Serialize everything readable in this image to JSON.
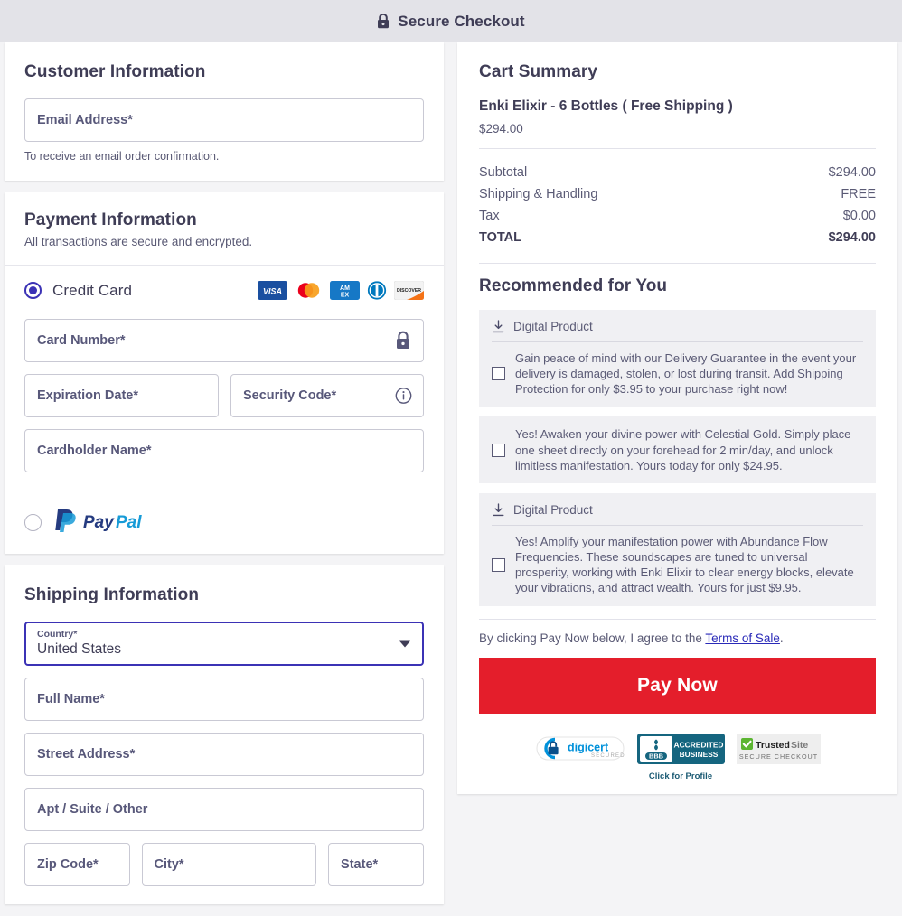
{
  "header": {
    "title": "Secure Checkout",
    "icon": "lock-icon"
  },
  "customer": {
    "heading": "Customer Information",
    "email_label": "Email Address*",
    "email_value": "",
    "email_hint": "To receive an email order confirmation."
  },
  "payment": {
    "heading": "Payment Information",
    "subheading": "All transactions are secure and encrypted.",
    "methods": [
      {
        "label": "Credit Card",
        "selected": true
      },
      {
        "label": "PayPal",
        "selected": false
      }
    ],
    "card_brands": [
      "visa",
      "mastercard",
      "amex",
      "diners-club",
      "discover"
    ],
    "fields": {
      "card_number": "Card Number*",
      "expiration": "Expiration Date*",
      "security_code": "Security Code*",
      "cardholder": "Cardholder Name*"
    },
    "card_number_icon": "lock-icon",
    "security_code_icon": "info-icon"
  },
  "shipping": {
    "heading": "Shipping Information",
    "country_label": "Country*",
    "country_value": "United States",
    "full_name": "Full Name*",
    "street": "Street Address*",
    "apt": "Apt / Suite / Other",
    "zip": "Zip Code*",
    "city": "City*",
    "state": "State*"
  },
  "cart": {
    "heading": "Cart Summary",
    "product_name": "Enki Elixir - 6 Bottles ( Free Shipping )",
    "product_price": "$294.00",
    "lines": [
      {
        "label": "Subtotal",
        "value": "$294.00"
      },
      {
        "label": "Shipping & Handling",
        "value": "FREE"
      },
      {
        "label": "Tax",
        "value": "$0.00"
      }
    ],
    "total_label": "TOTAL",
    "total_value": "$294.00"
  },
  "recommended": {
    "heading": "Recommended for You",
    "digital_tag": "Digital Product",
    "items": [
      {
        "digital": true,
        "checked": false,
        "text": "Gain peace of mind with our Delivery Guarantee in the event your delivery is damaged, stolen, or lost during transit. Add Shipping Protection for only $3.95 to your purchase right now!"
      },
      {
        "digital": false,
        "checked": false,
        "text": "Yes! Awaken your divine power with Celestial Gold. Simply place one sheet directly on your forehead for 2 min/day, and unlock limitless manifestation. Yours today for only $24.95."
      },
      {
        "digital": true,
        "checked": false,
        "text": "Yes! Amplify your manifestation power with Abundance Flow Frequencies. These soundscapes are tuned to universal prosperity, working with Enki Elixir to clear energy blocks, elevate your vibrations, and attract wealth.  Yours for just $9.95."
      }
    ]
  },
  "checkout": {
    "terms_prefix": "By clicking Pay Now below, I agree to the ",
    "terms_link": "Terms of Sale",
    "terms_suffix": ".",
    "pay_button": "Pay Now"
  },
  "badges": [
    {
      "name": "digicert",
      "primary": "digicert",
      "secondary": "SECURED"
    },
    {
      "name": "bbb",
      "primary": "ACCREDITED",
      "secondary": "BUSINESS",
      "caption": "Click for Profile",
      "mark": "BBB"
    },
    {
      "name": "trustedsite",
      "primary": "TrustedSite",
      "secondary": "SECURE CHECKOUT"
    }
  ],
  "colors": {
    "accent": "#3b32b5",
    "pay_button": "#e41e2b",
    "header_bg": "#e3e3e8",
    "text": "#3f3d56"
  }
}
